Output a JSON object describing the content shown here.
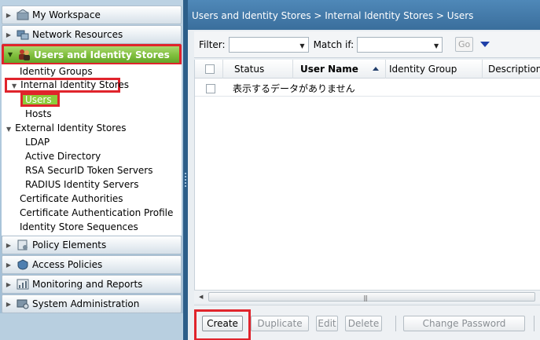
{
  "nav": {
    "sections_top": [
      {
        "label": "My Workspace",
        "icon": "workspace-icon"
      },
      {
        "label": "Network Resources",
        "icon": "network-icon"
      },
      {
        "label": "Users and Identity Stores",
        "icon": "users-icon",
        "active": true
      }
    ],
    "tree": {
      "identity_groups": "Identity Groups",
      "internal_identity_stores": "Internal Identity Stores",
      "users": "Users",
      "hosts": "Hosts",
      "external_identity_stores": "External Identity Stores",
      "ldap": "LDAP",
      "active_directory": "Active Directory",
      "rsa": "RSA SecurID Token Servers",
      "radius": "RADIUS Identity Servers",
      "cert_authorities": "Certificate Authorities",
      "cert_auth_profile": "Certificate Authentication Profile",
      "identity_store_sequences": "Identity Store Sequences"
    },
    "sections_bottom": [
      {
        "label": "Policy Elements",
        "icon": "policy-elements-icon"
      },
      {
        "label": "Access Policies",
        "icon": "access-policies-icon"
      },
      {
        "label": "Monitoring and Reports",
        "icon": "monitoring-icon"
      },
      {
        "label": "System Administration",
        "icon": "system-admin-icon"
      }
    ]
  },
  "breadcrumb": "Users and Identity Stores > Internal Identity Stores > Users",
  "filter": {
    "filter_label": "Filter:",
    "match_label": "Match if:",
    "go_label": "Go"
  },
  "grid": {
    "columns": [
      "Status",
      "User Name",
      "Identity Group",
      "Description"
    ],
    "empty_message": "表示するデータがありません"
  },
  "actions": {
    "create": "Create",
    "duplicate": "Duplicate",
    "edit": "Edit",
    "delete": "Delete",
    "change_password": "Change Password"
  },
  "colors": {
    "accent_green": "#7fbe3c",
    "highlight_red": "#e0242c",
    "header_blue": "#3a6e9c"
  }
}
